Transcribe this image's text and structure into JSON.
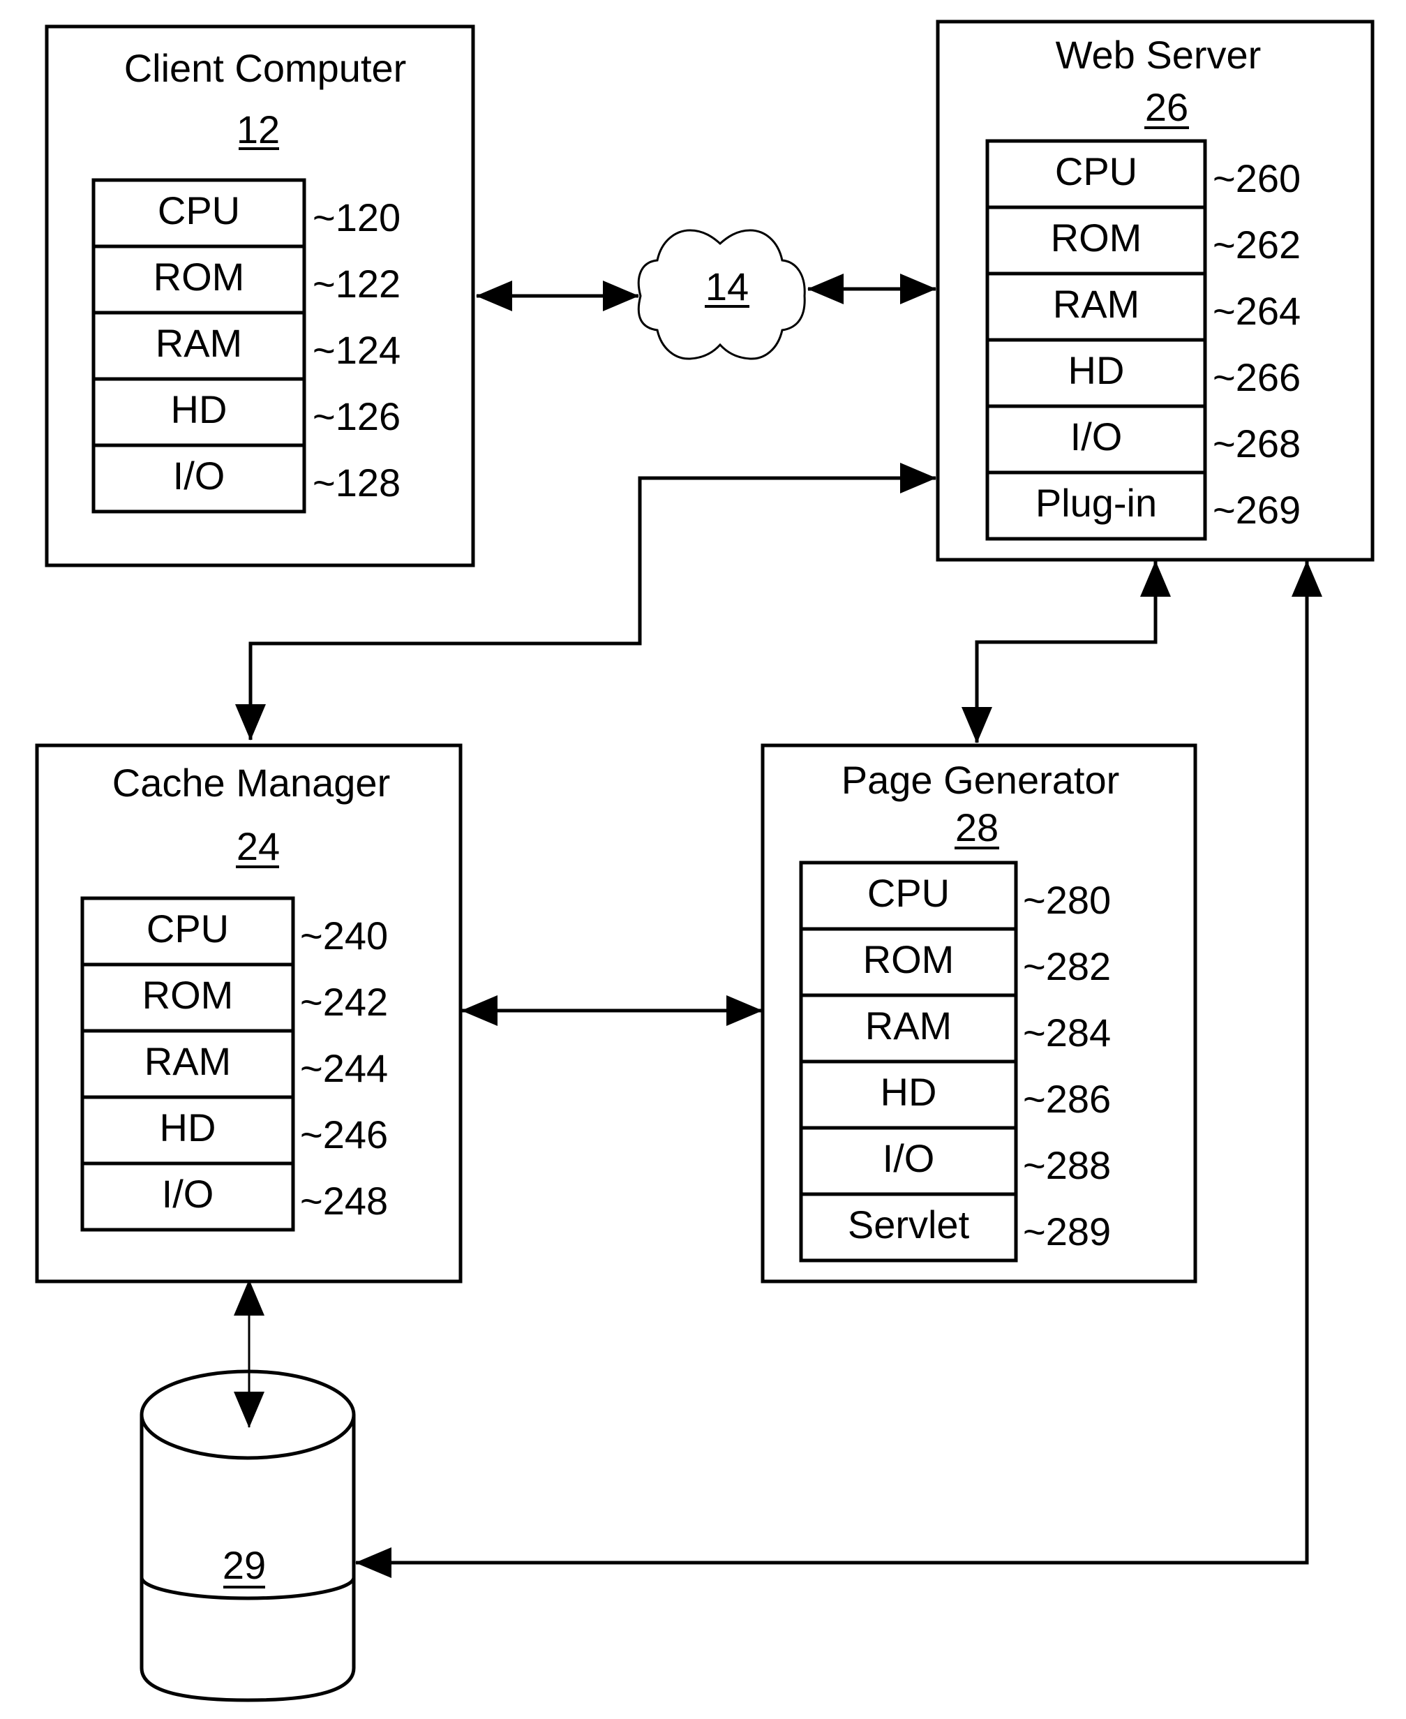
{
  "diagram": {
    "type": "system-block-diagram",
    "nodes": {
      "client": {
        "title": "Client Computer",
        "ref": "12",
        "components": [
          {
            "label": "CPU",
            "callout": "~120"
          },
          {
            "label": "ROM",
            "callout": "~122"
          },
          {
            "label": "RAM",
            "callout": "~124"
          },
          {
            "label": "HD",
            "callout": "~126"
          },
          {
            "label": "I/O",
            "callout": "~128"
          }
        ]
      },
      "network": {
        "shape": "cloud",
        "ref": "14"
      },
      "webserver": {
        "title": "Web Server",
        "ref": "26",
        "components": [
          {
            "label": "CPU",
            "callout": "~260"
          },
          {
            "label": "ROM",
            "callout": "~262"
          },
          {
            "label": "RAM",
            "callout": "~264"
          },
          {
            "label": "HD",
            "callout": "~266"
          },
          {
            "label": "I/O",
            "callout": "~268"
          },
          {
            "label": "Plug-in",
            "callout": "~269"
          }
        ]
      },
      "cache": {
        "title": "Cache Manager",
        "ref": "24",
        "components": [
          {
            "label": "CPU",
            "callout": "~240"
          },
          {
            "label": "ROM",
            "callout": "~242"
          },
          {
            "label": "RAM",
            "callout": "~244"
          },
          {
            "label": "HD",
            "callout": "~246"
          },
          {
            "label": "I/O",
            "callout": "~248"
          }
        ]
      },
      "pagegen": {
        "title": "Page Generator",
        "ref": "28",
        "components": [
          {
            "label": "CPU",
            "callout": "~280"
          },
          {
            "label": "ROM",
            "callout": "~282"
          },
          {
            "label": "RAM",
            "callout": "~284"
          },
          {
            "label": "HD",
            "callout": "~286"
          },
          {
            "label": "I/O",
            "callout": "~288"
          },
          {
            "label": "Servlet",
            "callout": "~289"
          }
        ]
      },
      "database": {
        "shape": "cylinder",
        "ref": "29"
      }
    },
    "edges": [
      {
        "from": "client",
        "to": "network",
        "direction": "bidirectional"
      },
      {
        "from": "network",
        "to": "webserver",
        "direction": "bidirectional"
      },
      {
        "from": "webserver",
        "to": "cache",
        "direction": "bidirectional"
      },
      {
        "from": "webserver",
        "to": "pagegen",
        "direction": "bidirectional"
      },
      {
        "from": "cache",
        "to": "pagegen",
        "direction": "bidirectional"
      },
      {
        "from": "cache",
        "to": "database",
        "direction": "bidirectional"
      },
      {
        "from": "webserver",
        "to": "database",
        "direction": "bidirectional"
      }
    ]
  }
}
